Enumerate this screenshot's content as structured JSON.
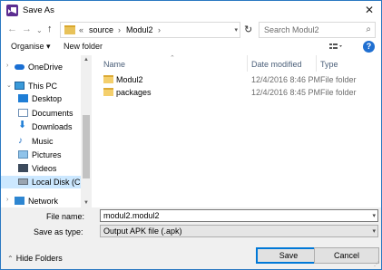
{
  "window": {
    "title": "Save As",
    "close_glyph": "✕"
  },
  "nav": {
    "back_glyph": "←",
    "forward_glyph": "→",
    "dropdown_glyph": "⌄",
    "up_glyph": "↑",
    "breadcrumb": [
      "«",
      "source",
      "Modul2"
    ],
    "refresh_glyph": "↻",
    "search_placeholder": "Search Modul2"
  },
  "toolbar": {
    "organise": "Organise ▾",
    "new_folder": "New folder",
    "help": "?"
  },
  "sidebar": {
    "items": [
      {
        "label": "OneDrive",
        "icon": "onedrive-icon"
      },
      {
        "label": "This PC",
        "icon": "computer-icon"
      },
      {
        "label": "Desktop",
        "icon": "desktop-icon"
      },
      {
        "label": "Documents",
        "icon": "documents-icon"
      },
      {
        "label": "Downloads",
        "icon": "downloads-icon"
      },
      {
        "label": "Music",
        "icon": "music-icon"
      },
      {
        "label": "Pictures",
        "icon": "pictures-icon"
      },
      {
        "label": "Videos",
        "icon": "videos-icon"
      },
      {
        "label": "Local Disk (C:)",
        "icon": "disk-icon"
      },
      {
        "label": "Network",
        "icon": "network-icon"
      }
    ]
  },
  "files": {
    "columns": [
      "Name",
      "Date modified",
      "Type"
    ],
    "rows": [
      {
        "name": "Modul2",
        "date": "12/4/2016 8:46 PM",
        "type": "File folder"
      },
      {
        "name": "packages",
        "date": "12/4/2016 8:45 PM",
        "type": "File folder"
      }
    ]
  },
  "form": {
    "file_name_label": "File name:",
    "file_name_value": "modul2.modul2",
    "save_type_label": "Save as type:",
    "save_type_value": "Output APK file (.apk)"
  },
  "footer": {
    "hide_folders": "Hide Folders",
    "save": "Save",
    "cancel": "Cancel"
  },
  "colors": {
    "accent": "#0078d7",
    "selection": "#cce8ff",
    "folder": "#f4cf6c"
  }
}
